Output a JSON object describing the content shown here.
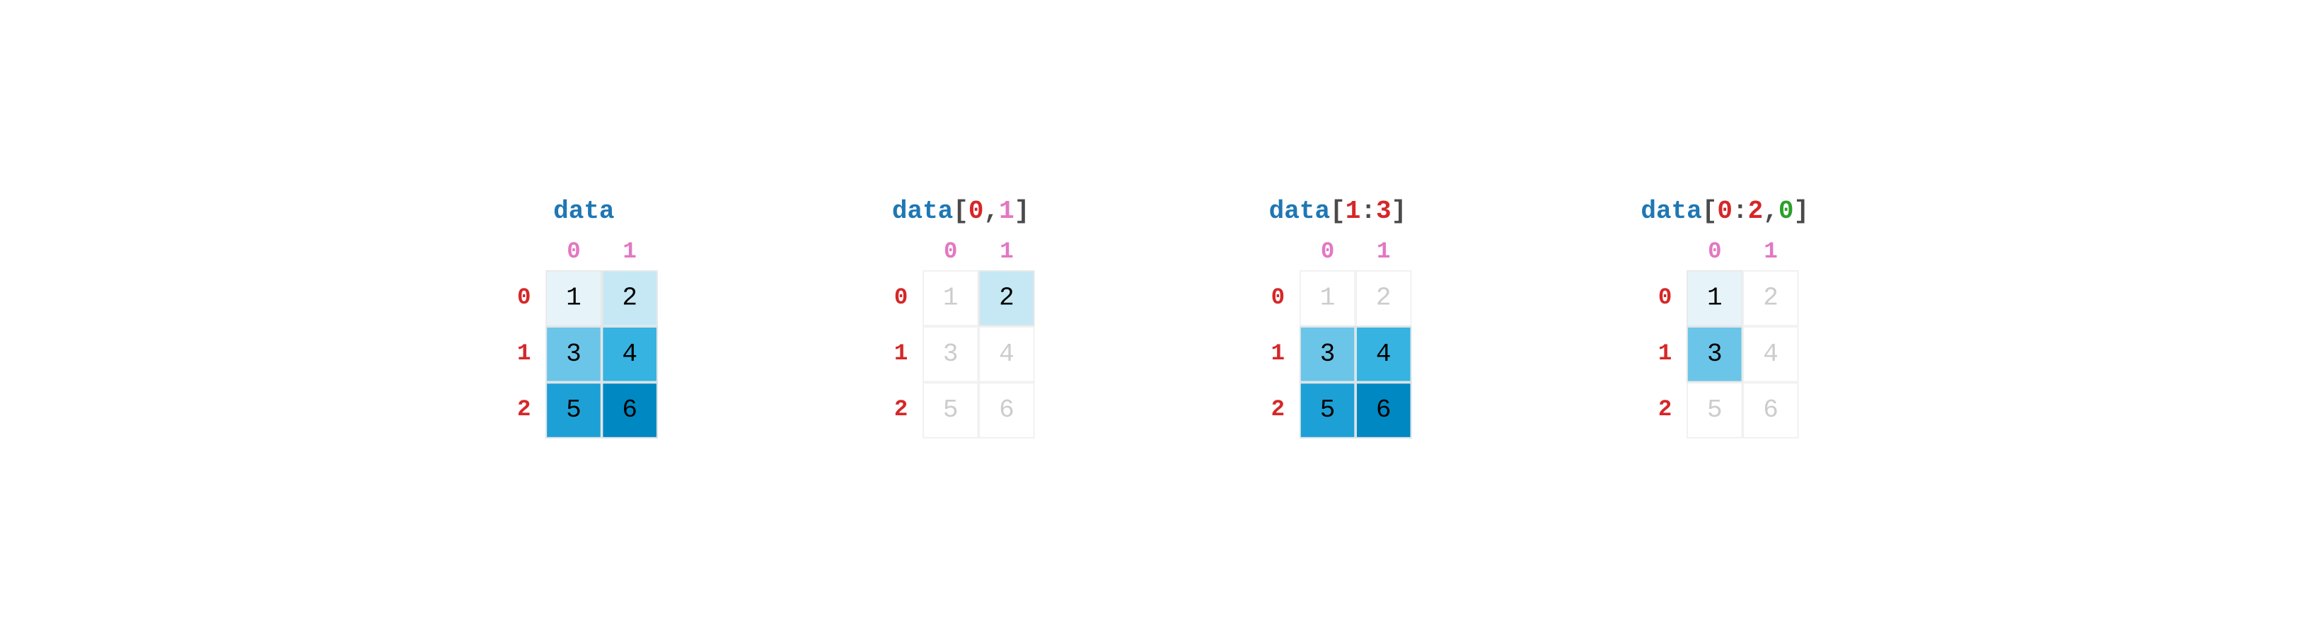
{
  "panels": [
    {
      "title_parts": [
        {
          "text": "data",
          "cls": "t-blue"
        }
      ],
      "col_headers": [
        "0",
        "1"
      ],
      "row_headers": [
        "0",
        "1",
        "2"
      ],
      "cells": [
        [
          {
            "v": "1",
            "shade": "shade-1",
            "active": true
          },
          {
            "v": "2",
            "shade": "shade-2",
            "active": true
          }
        ],
        [
          {
            "v": "3",
            "shade": "shade-3",
            "active": true
          },
          {
            "v": "4",
            "shade": "shade-4",
            "active": true
          }
        ],
        [
          {
            "v": "5",
            "shade": "shade-5",
            "active": true
          },
          {
            "v": "6",
            "shade": "shade-6",
            "active": true
          }
        ]
      ]
    },
    {
      "title_parts": [
        {
          "text": "data",
          "cls": "t-blue"
        },
        {
          "text": "[",
          "cls": "t-dark"
        },
        {
          "text": "0",
          "cls": "t-magenta"
        },
        {
          "text": ",",
          "cls": "t-dark"
        },
        {
          "text": "1",
          "cls": "t-pink"
        },
        {
          "text": "]",
          "cls": "t-dark"
        }
      ],
      "col_headers": [
        "0",
        "1"
      ],
      "row_headers": [
        "0",
        "1",
        "2"
      ],
      "cells": [
        [
          {
            "v": "1",
            "shade": "",
            "active": false
          },
          {
            "v": "2",
            "shade": "shade-2",
            "active": true
          }
        ],
        [
          {
            "v": "3",
            "shade": "",
            "active": false
          },
          {
            "v": "4",
            "shade": "",
            "active": false
          }
        ],
        [
          {
            "v": "5",
            "shade": "",
            "active": false
          },
          {
            "v": "6",
            "shade": "",
            "active": false
          }
        ]
      ]
    },
    {
      "title_parts": [
        {
          "text": "data",
          "cls": "t-blue"
        },
        {
          "text": "[",
          "cls": "t-dark"
        },
        {
          "text": "1",
          "cls": "t-magenta"
        },
        {
          "text": ":",
          "cls": "t-dark"
        },
        {
          "text": "3",
          "cls": "t-magenta"
        },
        {
          "text": "]",
          "cls": "t-dark"
        }
      ],
      "col_headers": [
        "0",
        "1"
      ],
      "row_headers": [
        "0",
        "1",
        "2"
      ],
      "cells": [
        [
          {
            "v": "1",
            "shade": "",
            "active": false
          },
          {
            "v": "2",
            "shade": "",
            "active": false
          }
        ],
        [
          {
            "v": "3",
            "shade": "shade-3",
            "active": true
          },
          {
            "v": "4",
            "shade": "shade-4",
            "active": true
          }
        ],
        [
          {
            "v": "5",
            "shade": "shade-5",
            "active": true
          },
          {
            "v": "6",
            "shade": "shade-6",
            "active": true
          }
        ]
      ]
    },
    {
      "title_parts": [
        {
          "text": "data",
          "cls": "t-blue"
        },
        {
          "text": "[",
          "cls": "t-dark"
        },
        {
          "text": "0",
          "cls": "t-magenta"
        },
        {
          "text": ":",
          "cls": "t-dark"
        },
        {
          "text": "2",
          "cls": "t-magenta"
        },
        {
          "text": ",",
          "cls": "t-dark"
        },
        {
          "text": "0",
          "cls": "t-green"
        },
        {
          "text": "]",
          "cls": "t-dark"
        }
      ],
      "col_headers": [
        "0",
        "1"
      ],
      "row_headers": [
        "0",
        "1",
        "2"
      ],
      "cells": [
        [
          {
            "v": "1",
            "shade": "shade-1",
            "active": true
          },
          {
            "v": "2",
            "shade": "",
            "active": false
          }
        ],
        [
          {
            "v": "3",
            "shade": "shade-3",
            "active": true
          },
          {
            "v": "4",
            "shade": "",
            "active": false
          }
        ],
        [
          {
            "v": "5",
            "shade": "",
            "active": false
          },
          {
            "v": "6",
            "shade": "",
            "active": false
          }
        ]
      ]
    }
  ]
}
